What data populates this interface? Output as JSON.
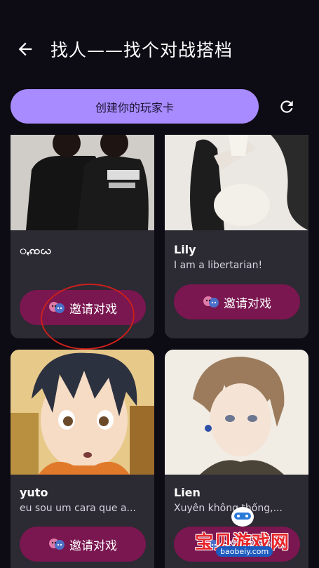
{
  "header": {
    "title": "找人——找个对战搭档"
  },
  "toolbar": {
    "create_label": "创建你的玩家卡"
  },
  "cards": [
    {
      "name": "ꩻꩡꩬ",
      "bio": "",
      "invite_label": "邀请对戏"
    },
    {
      "name": "Lily",
      "bio": "I am a libertarian!",
      "invite_label": "邀请对戏"
    },
    {
      "name": "yuto",
      "bio": "eu sou um cara que a...",
      "invite_label": "邀请对戏"
    },
    {
      "name": "Lien",
      "bio": "Xuyên không thống,...",
      "invite_label": "邀请对戏"
    }
  ],
  "watermark": {
    "text": "宝贝游戏网",
    "url": "baobeiy.com"
  },
  "colors": {
    "background": "#0d0b14",
    "create_button": "#a88cff",
    "invite_button": "#7a1650",
    "card": "#2c2a33",
    "annotation": "#c9201c"
  }
}
